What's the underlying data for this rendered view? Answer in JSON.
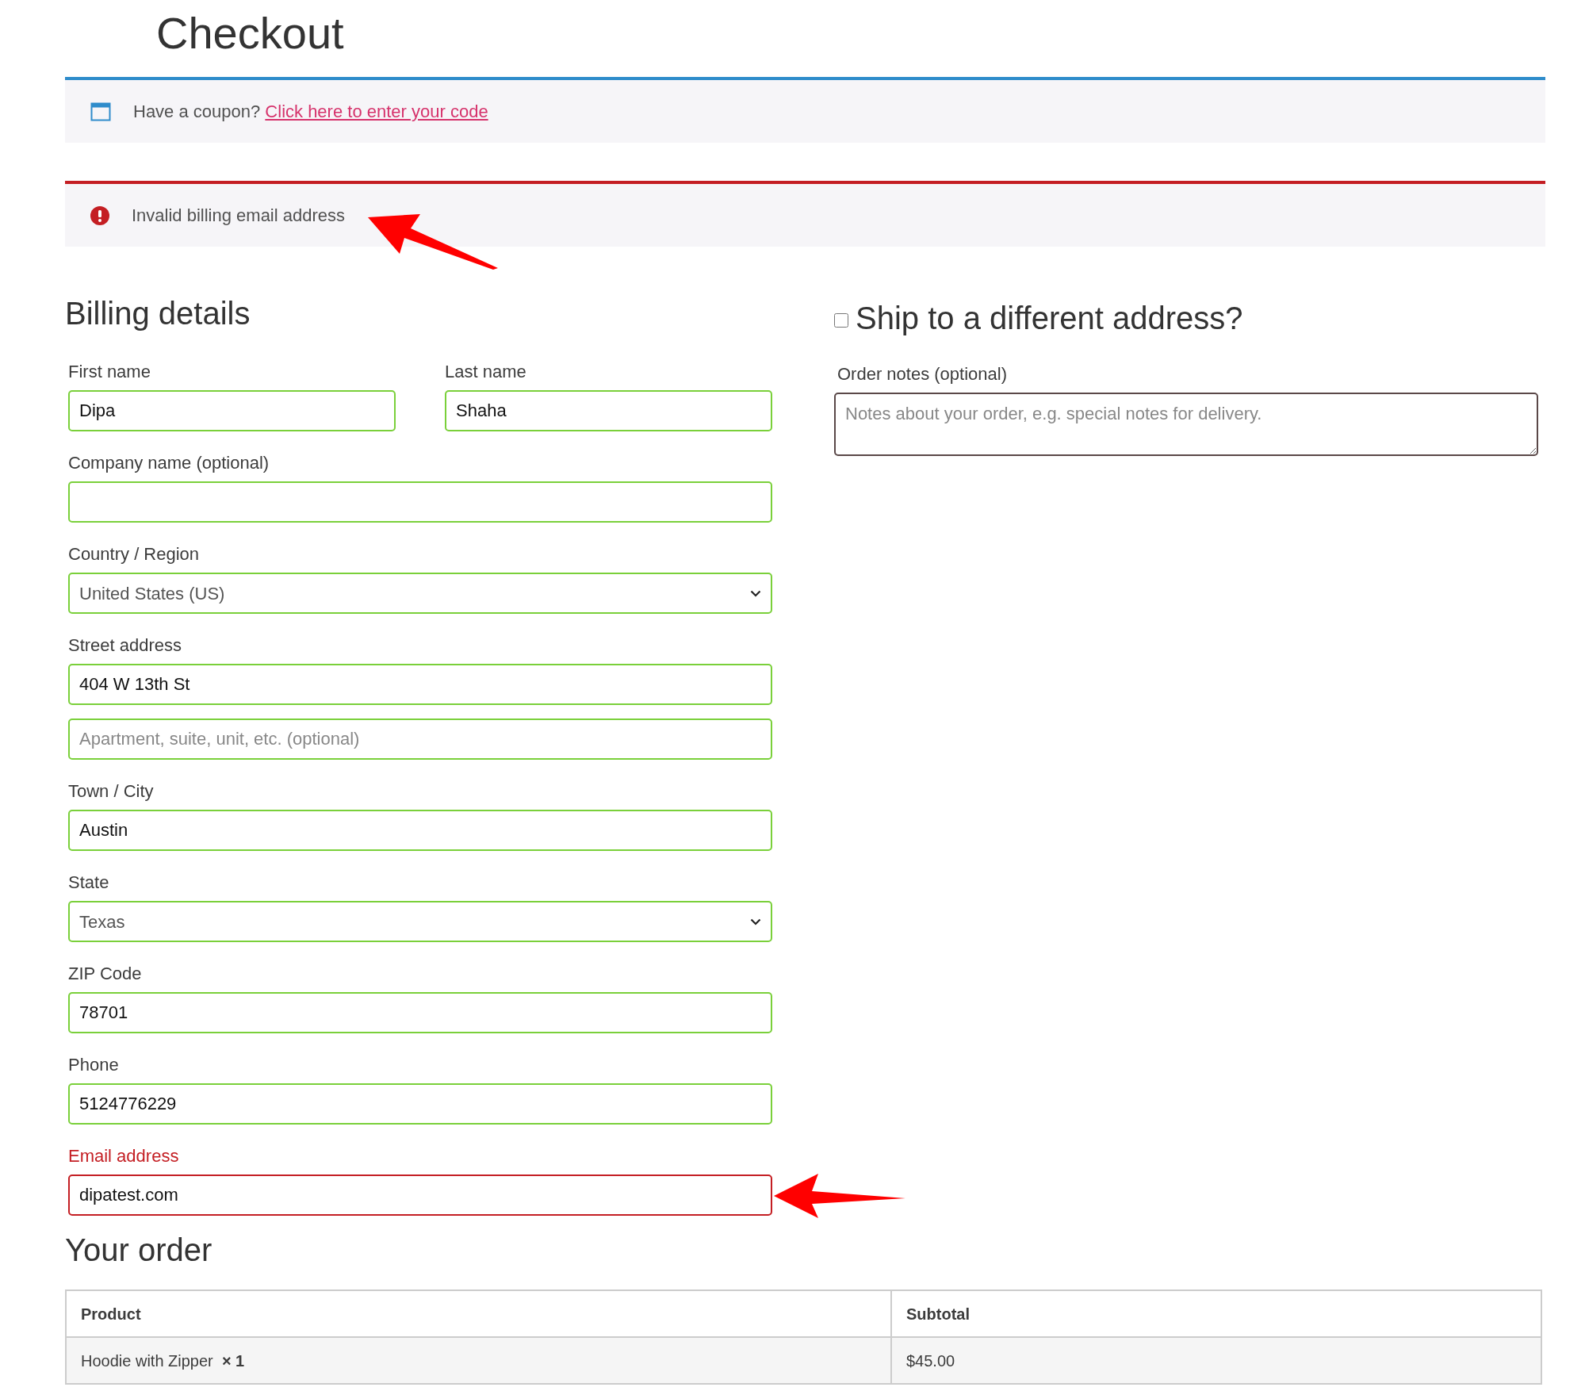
{
  "page_title": "Checkout",
  "notices": [
    {
      "kind": "info",
      "text": "Have a coupon?",
      "link": "Click here to enter your code"
    },
    {
      "kind": "error",
      "text": "Invalid billing email address"
    }
  ],
  "billing": {
    "heading": "Billing details",
    "fields": [
      {
        "kind": "text",
        "label": "First name",
        "value": "Dipa",
        "half": true,
        "invalid": false
      },
      {
        "kind": "text",
        "label": "Last name",
        "value": "Shaha",
        "half": true,
        "invalid": false
      },
      {
        "kind": "text",
        "label": "Company name (optional)",
        "half": false,
        "invalid": false
      },
      {
        "kind": "select",
        "label": "Country / Region",
        "value": "United States (US)",
        "half": false,
        "invalid": false
      },
      {
        "kind": "text",
        "label": "Street address",
        "value": "404 W 13th St",
        "half": false,
        "invalid": false
      },
      {
        "kind": "text",
        "placeholder": "Apartment, suite, unit, etc. (optional)",
        "half": false,
        "invalid": false
      },
      {
        "kind": "text",
        "label": "Town / City",
        "value": "Austin",
        "half": false,
        "invalid": false
      },
      {
        "kind": "select",
        "label": "State",
        "value": "Texas",
        "half": false,
        "invalid": false
      },
      {
        "kind": "text",
        "label": "ZIP Code",
        "value": "78701",
        "half": false,
        "invalid": false
      },
      {
        "kind": "text",
        "label": "Phone",
        "value": "5124776229",
        "half": false,
        "invalid": false
      },
      {
        "kind": "text",
        "label": "Email address",
        "value": "dipatest.com",
        "half": false,
        "invalid": true
      }
    ]
  },
  "shipping": {
    "heading": "Ship to a different address?",
    "checked": false,
    "notes_label": "Order notes (optional)",
    "notes_placeholder": "Notes about your order, e.g. special notes for delivery."
  },
  "order": {
    "heading": "Your order",
    "columns": [
      "Product",
      "Subtotal"
    ],
    "rows": [
      {
        "product": "Hoodie with Zipper",
        "quantity": "× 1",
        "subtotal": "$45.00"
      }
    ]
  }
}
